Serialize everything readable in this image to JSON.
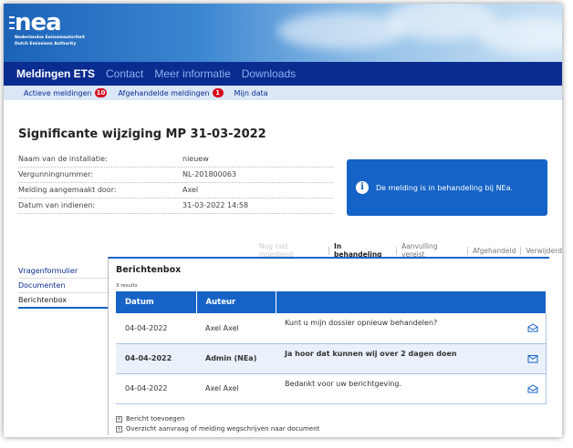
{
  "brand": {
    "logo": "nea",
    "sub_line1": "Nederlandse Emissieautoriteit",
    "sub_line2": "Dutch Emissions Authority"
  },
  "main_nav": {
    "items": [
      {
        "label": "Meldingen ETS",
        "active": true
      },
      {
        "label": "Contact",
        "active": false
      },
      {
        "label": "Meer informatie",
        "active": false
      },
      {
        "label": "Downloads",
        "active": false
      }
    ]
  },
  "sub_nav": {
    "items": [
      {
        "label": "Actieve meldingen",
        "badge": "10"
      },
      {
        "label": "Afgehandelde meldingen",
        "badge": "1"
      },
      {
        "label": "Mijn data",
        "badge": ""
      }
    ]
  },
  "page": {
    "title": "Significante wijziging MP 31-03-2022"
  },
  "info": [
    {
      "label": "Naam van de installatie:",
      "value": "nieuew"
    },
    {
      "label": "Vergunningnummer:",
      "value": "NL-201800063"
    },
    {
      "label": "Melding aangemaakt door:",
      "value": "Axel"
    },
    {
      "label": "Datum van indienen:",
      "value": "31-03-2022 14:58"
    }
  ],
  "notice": {
    "text": "De melding is in behandeling bij NEa.",
    "icon": "info-icon",
    "color": "#1563c7"
  },
  "status_steps": [
    {
      "label": "Nog niet ingediend",
      "state": "disabled"
    },
    {
      "label": "In behandeling",
      "state": "current"
    },
    {
      "label": "Aanvulling vereist",
      "state": "normal"
    },
    {
      "label": "Afgehandeld",
      "state": "normal"
    },
    {
      "label": "Verwijderd",
      "state": "normal"
    }
  ],
  "side_nav": [
    {
      "label": "Vragenformulier",
      "active": false
    },
    {
      "label": "Documenten",
      "active": false
    },
    {
      "label": "Berichtenbox",
      "active": true
    }
  ],
  "message_box": {
    "title": "Berichtenbox",
    "results": "3 results",
    "columns": [
      "Datum",
      "Auteur",
      ""
    ],
    "rows": [
      {
        "date": "04-04-2022",
        "author": "Axel Axel",
        "message": "Kunt u mijn dossier opnieuw behandelen?",
        "icon": "envelope-open-icon",
        "highlight": false
      },
      {
        "date": "04-04-2022",
        "author": "Admin (NEa)",
        "message": "Ja hoor dat kunnen wij over 2 dagen doen",
        "icon": "envelope-closed-icon",
        "highlight": true
      },
      {
        "date": "04-04-2022",
        "author": "Axel Axel",
        "message": "Bedankt voor uw berichtgeving.",
        "icon": "envelope-open-icon",
        "highlight": false
      }
    ],
    "links": [
      {
        "label": "Bericht toevoegen"
      },
      {
        "label": "Overzicht aanvraag of melding wegschrijven naar document"
      }
    ]
  }
}
